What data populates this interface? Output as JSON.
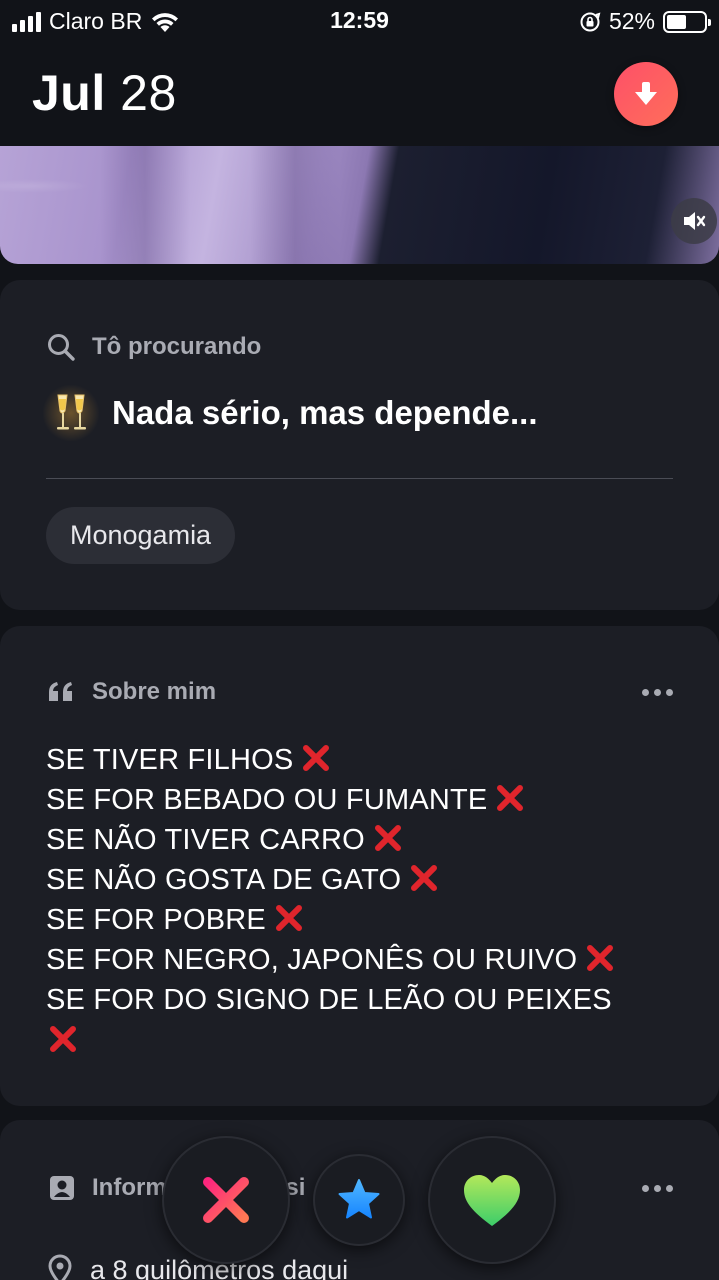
{
  "status_bar": {
    "carrier": "Claro BR",
    "time": "12:59",
    "battery_percent": "52%",
    "battery_level": 0.52
  },
  "header": {
    "date_month": "Jul",
    "date_day": "28",
    "download_icon": "arrow-down-icon",
    "accent_color": "#fd5068"
  },
  "photo": {
    "mute_icon": "speaker-muted-icon"
  },
  "looking_for": {
    "title": "Tô procurando",
    "emoji": "🥂",
    "value": "Nada sério, mas depende...",
    "tag": "Monogamia"
  },
  "about": {
    "title": "Sobre mim",
    "lines": [
      "SE TIVER FILHOS",
      "SE FOR BEBADO OU FUMANTE",
      "SE NÃO TIVER CARRO",
      "SE NÃO GOSTA DE GATO",
      "SE FOR POBRE",
      "SE FOR NEGRO, JAPONÊS OU RUIVO",
      "SE FOR DO SIGNO DE LEÃO OU PEIXES"
    ],
    "line_icon": "red-cross-mark-icon"
  },
  "basic_info": {
    "title_visible": "Inform",
    "title_tail": "ási",
    "distance": "a 8 quilômetros daqui"
  },
  "actions": {
    "nope_icon": "x-icon",
    "super_like_icon": "star-icon",
    "like_icon": "heart-icon",
    "nope_color": "#fd267d",
    "super_like_color": "#1786ff",
    "like_color": "#6fe34c"
  }
}
